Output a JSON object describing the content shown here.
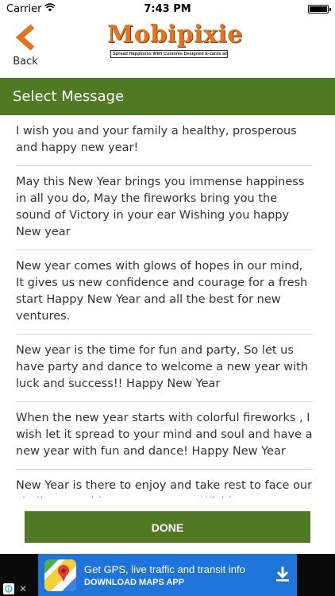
{
  "status_bar": {
    "carrier": "Carrier",
    "time": "7:43 PM"
  },
  "header": {
    "back_label": "Back",
    "logo_title": "Mobipixie",
    "logo_tagline": "Spread Happiness With Customs Designed E-cards and Greeting cards"
  },
  "title_bar": {
    "title": "Select Message"
  },
  "messages": [
    "I wish you and your family a healthy, prosperous and happy new year!",
    "May this New Year brings you immense happiness in all you do, May the fireworks bring you the sound of Victory in your ear Wishing you happy New year",
    "New year comes with glows of hopes in our mind, It gives us new confidence and courage for a fresh start Happy New Year and all the best for new ventures.",
    "New year is the time for fun and party, So let us have party and dance to welcome a new year with luck and success!! Happy New Year",
    "When the new year starts with colorful fireworks , I wish let it spread to your mind and soul and have a new year with fun and dance! Happy New Year",
    "New Year is there to enjoy and take rest to face our challenges with more courage . Wishing you a great"
  ],
  "done_button": {
    "label": "DONE"
  },
  "ad": {
    "line1": "Get GPS, live traffic and transit info",
    "line2": "DOWNLOAD MAPS APP"
  },
  "colors": {
    "accent_green": "#4f7a23",
    "logo_orange": "#e2731f",
    "ad_blue": "#1e74d9"
  }
}
